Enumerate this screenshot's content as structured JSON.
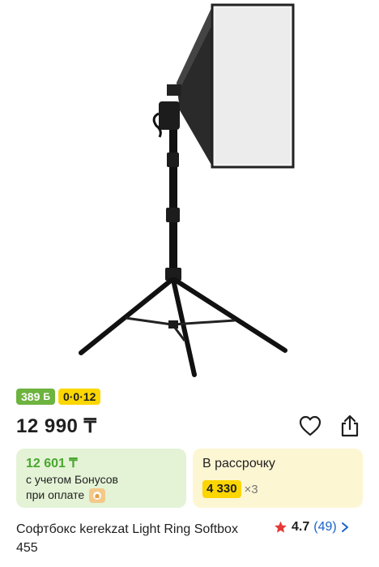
{
  "badges": {
    "bonus": "389",
    "bonus_currency": "Б",
    "installment": "0·0·12"
  },
  "price": "12 990 ₸",
  "bonus_card": {
    "price": "12 601 ₸",
    "line1": "с учетом Бонусов",
    "line2": "при оплате"
  },
  "installment_card": {
    "title": "В рассрочку",
    "amount": "4 330",
    "multiplier": "×3"
  },
  "product": {
    "title": "Софтбокс kerekzat Light Ring Softbox 455"
  },
  "rating": {
    "value": "4.7",
    "count": "(49)"
  },
  "colors": {
    "bonus_green": "#6db33f",
    "yellow": "#fcd600",
    "star": "#e53935",
    "link": "#1a63c9"
  }
}
